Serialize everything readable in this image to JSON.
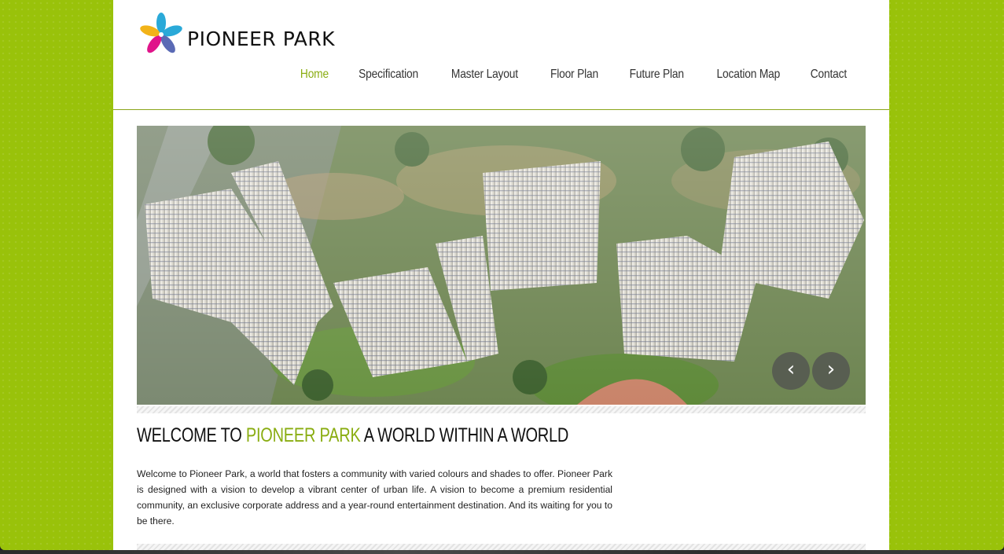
{
  "brand": {
    "name": "Pioneer Park"
  },
  "nav": {
    "items": [
      {
        "label": "Home",
        "active": true
      },
      {
        "label": "Specification",
        "active": false
      },
      {
        "label": "Master Layout",
        "active": false
      },
      {
        "label": "Floor Plan",
        "active": false
      },
      {
        "label": "Future Plan",
        "active": false
      },
      {
        "label": "Location Map",
        "active": false
      },
      {
        "label": "Contact",
        "active": false
      }
    ]
  },
  "slider": {
    "prev_glyph": "‹",
    "next_glyph": "›"
  },
  "welcome": {
    "prefix": "WELCOME TO",
    "highlight": "PIONEER PARK",
    "suffix": "A WORLD WITHIN A WORLD"
  },
  "intro": {
    "text": "Welcome to Pioneer Park, a world that fosters a community with varied colours and shades to offer. Pioneer Park is designed with a vision to develop a vibrant center of urban life. A vision to become a premium residential community, an exclusive corporate address and a year-round entertainment destination. And its waiting for you to be there."
  },
  "colors": {
    "accent": "#8aad12",
    "page_background": "#99c20a",
    "content_background": "#ffffff"
  },
  "icons": {
    "logo": "flower-logo-icon",
    "prev": "chevron-left-icon",
    "next": "chevron-right-icon"
  }
}
